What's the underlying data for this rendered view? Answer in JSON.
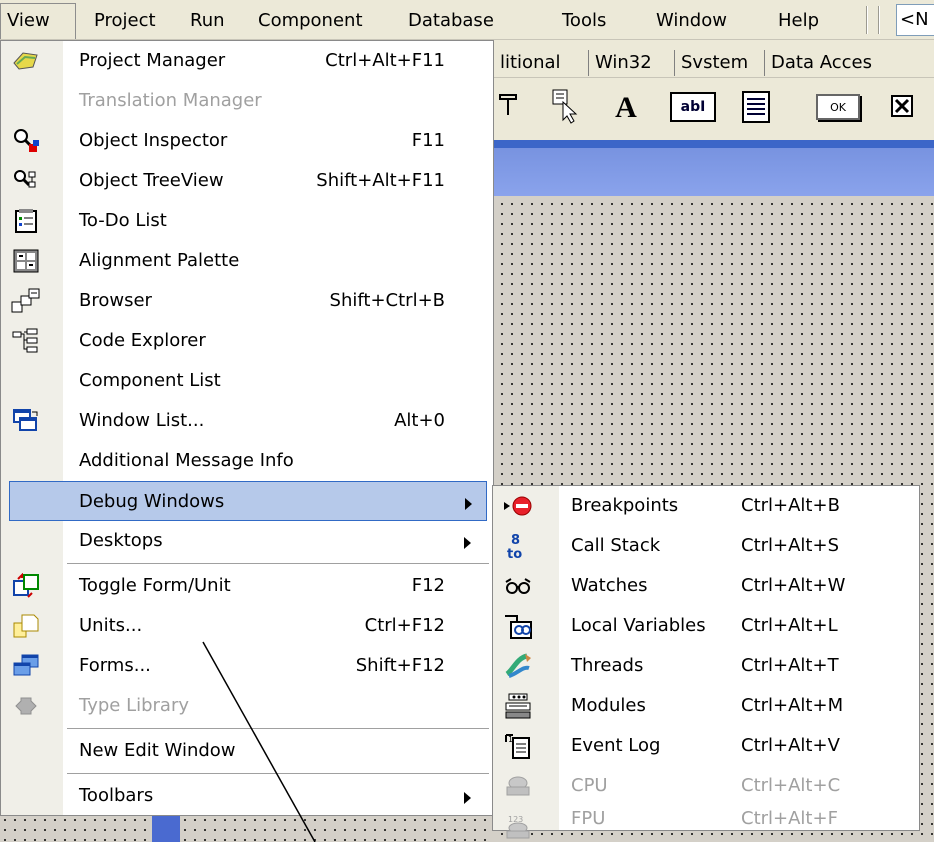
{
  "menubar": {
    "items": [
      "View",
      "Project",
      "Run",
      "Component",
      "Database",
      "Tools",
      "Window",
      "Help"
    ],
    "combo_text": "<N"
  },
  "palette_tabs": [
    "litional",
    "Win32",
    "Svstem",
    "Data Acces"
  ],
  "toolbar": {
    "label_button": "A",
    "edit_text": "abI",
    "ok_text": "OK"
  },
  "view_menu": {
    "items": [
      {
        "label": "Project Manager",
        "shortcut": "Ctrl+Alt+F11",
        "icon": "project-manager-icon"
      },
      {
        "label": "Translation Manager",
        "shortcut": "",
        "icon": "",
        "disabled": true
      },
      {
        "label": "Object Inspector",
        "shortcut": "F11",
        "icon": "object-inspector-icon"
      },
      {
        "label": "Object TreeView",
        "shortcut": "Shift+Alt+F11",
        "icon": "object-treeview-icon"
      },
      {
        "label": "To-Do List",
        "shortcut": "",
        "icon": "todo-list-icon"
      },
      {
        "label": "Alignment Palette",
        "shortcut": "",
        "icon": "alignment-palette-icon"
      },
      {
        "label": "Browser",
        "shortcut": "Shift+Ctrl+B",
        "icon": "browser-icon"
      },
      {
        "label": "Code Explorer",
        "shortcut": "",
        "icon": "code-explorer-icon"
      },
      {
        "label": "Component List",
        "shortcut": "",
        "icon": ""
      },
      {
        "label": "Window List...",
        "shortcut": "Alt+0",
        "icon": "window-list-icon"
      },
      {
        "label": "Additional Message Info",
        "shortcut": "",
        "icon": ""
      },
      {
        "label": "Debug Windows",
        "shortcut": "",
        "icon": "",
        "submenu": true,
        "highlighted": true
      },
      {
        "label": "Desktops",
        "shortcut": "",
        "icon": "",
        "submenu": true
      },
      {
        "label": "Toggle Form/Unit",
        "shortcut": "F12",
        "icon": "toggle-form-unit-icon"
      },
      {
        "label": "Units...",
        "shortcut": "Ctrl+F12",
        "icon": "units-icon"
      },
      {
        "label": "Forms...",
        "shortcut": "Shift+F12",
        "icon": "forms-icon"
      },
      {
        "label": "Type Library",
        "shortcut": "",
        "icon": "type-library-icon",
        "disabled": true
      },
      {
        "label": "New Edit Window",
        "shortcut": "",
        "icon": ""
      },
      {
        "label": "Toolbars",
        "shortcut": "",
        "icon": "",
        "submenu": true
      }
    ]
  },
  "debug_submenu": {
    "items": [
      {
        "label": "Breakpoints",
        "shortcut": "Ctrl+Alt+B",
        "icon": "breakpoints-icon"
      },
      {
        "label": "Call Stack",
        "shortcut": "Ctrl+Alt+S",
        "icon": "call-stack-icon"
      },
      {
        "label": "Watches",
        "shortcut": "Ctrl+Alt+W",
        "icon": "watches-icon"
      },
      {
        "label": "Local Variables",
        "shortcut": "Ctrl+Alt+L",
        "icon": "local-variables-icon"
      },
      {
        "label": "Threads",
        "shortcut": "Ctrl+Alt+T",
        "icon": "threads-icon"
      },
      {
        "label": "Modules",
        "shortcut": "Ctrl+Alt+M",
        "icon": "modules-icon"
      },
      {
        "label": "Event Log",
        "shortcut": "Ctrl+Alt+V",
        "icon": "event-log-icon"
      },
      {
        "label": "CPU",
        "shortcut": "Ctrl+Alt+C",
        "icon": "cpu-icon",
        "disabled": true
      },
      {
        "label": "FPU",
        "shortcut": "Ctrl+Alt+F",
        "icon": "fpu-icon",
        "disabled": true
      }
    ]
  },
  "colors": {
    "highlight_bg": "#b6c9ea",
    "highlight_border": "#316ac5",
    "disabled_text": "#a0a0a0",
    "form_title": "#7893e0"
  }
}
